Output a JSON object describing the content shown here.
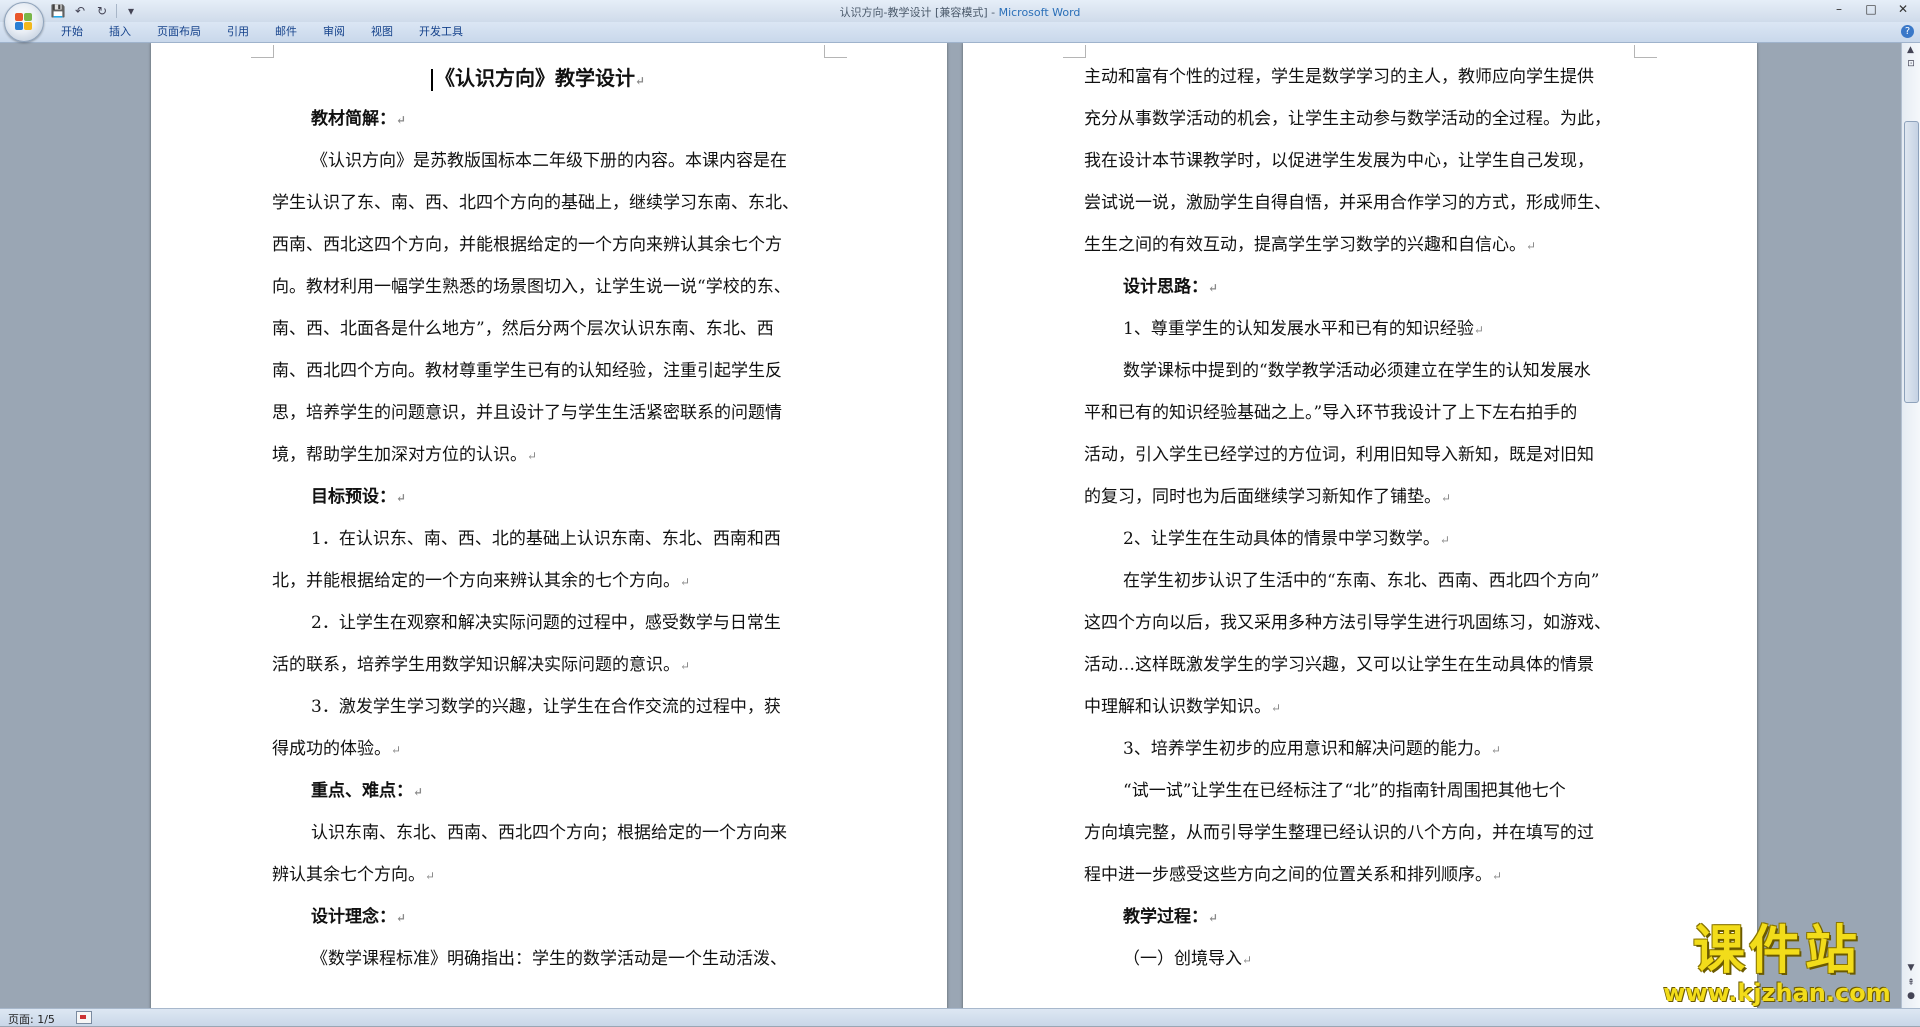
{
  "window": {
    "title_doc": "认识方向-教学设计 [兼容模式] - ",
    "title_app": "Microsoft Word",
    "minimize": "–",
    "maximize": "□",
    "close": "✕"
  },
  "qat": {
    "save_icon": "💾",
    "undo_icon": "↶",
    "redo_icon": "↻",
    "customize_icon": "▾"
  },
  "ribbon": {
    "tabs": [
      "开始",
      "插入",
      "页面布局",
      "引用",
      "邮件",
      "审阅",
      "视图",
      "开发工具"
    ],
    "help": "?"
  },
  "page1": {
    "title": "《认识方向》教学设计",
    "lines": [
      {
        "text": "教材简解：",
        "bold": true,
        "indent": true,
        "mark": true
      },
      {
        "text": "《认识方向》是苏教版国标本二年级下册的内容。本课内容是在",
        "indent": true
      },
      {
        "text": "学生认识了东、南、西、北四个方向的基础上，继续学习东南、东北、"
      },
      {
        "text": "西南、西北这四个方向，并能根据给定的一个方向来辨认其余七个方"
      },
      {
        "text": "向。教材利用一幅学生熟悉的场景图切入，让学生说一说“学校的东、"
      },
      {
        "text": "南、西、北面各是什么地方”，然后分两个层次认识东南、东北、西"
      },
      {
        "text": "南、西北四个方向。教材尊重学生已有的认知经验，注重引起学生反"
      },
      {
        "text": "思，培养学生的问题意识，并且设计了与学生生活紧密联系的问题情"
      },
      {
        "text": "境，帮助学生加深对方位的认识。",
        "mark": true
      },
      {
        "text": "目标预设：",
        "bold": true,
        "indent": true,
        "mark": true
      },
      {
        "text": "1．在认识东、南、西、北的基础上认识东南、东北、西南和西",
        "indent": true
      },
      {
        "text": "北，并能根据给定的一个方向来辨认其余的七个方向。",
        "mark": true
      },
      {
        "text": "2．让学生在观察和解决实际问题的过程中，感受数学与日常生",
        "indent": true
      },
      {
        "text": "活的联系，培养学生用数学知识解决实际问题的意识。",
        "mark": true
      },
      {
        "text": "3．激发学生学习数学的兴趣，让学生在合作交流的过程中，获",
        "indent": true
      },
      {
        "text": "得成功的体验。",
        "mark": true
      },
      {
        "text": "重点、难点：",
        "bold": true,
        "indent": true,
        "mark": true
      },
      {
        "text": "认识东南、东北、西南、西北四个方向；根据给定的一个方向来",
        "indent": true
      },
      {
        "text": "辨认其余七个方向。",
        "mark": true
      },
      {
        "text": "设计理念：",
        "bold": true,
        "indent": true,
        "mark": true
      },
      {
        "text": "《数学课程标准》明确指出：学生的数学活动是一个生动活泼、",
        "indent": true
      }
    ]
  },
  "page2": {
    "lines": [
      {
        "text": "主动和富有个性的过程，学生是数学学习的主人，教师应向学生提供"
      },
      {
        "text": "充分从事数学活动的机会，让学生主动参与数学活动的全过程。为此，"
      },
      {
        "text": "我在设计本节课教学时，以促进学生发展为中心，让学生自己发现，"
      },
      {
        "text": "尝试说一说，激励学生自得自悟，并采用合作学习的方式，形成师生、"
      },
      {
        "text": "生生之间的有效互动，提高学生学习数学的兴趣和自信心。",
        "mark": true
      },
      {
        "text": "设计思路：",
        "bold": true,
        "indent": true,
        "mark": true
      },
      {
        "text": "1、尊重学生的认知发展水平和已有的知识经验",
        "indent": true,
        "mark": true
      },
      {
        "text": "数学课标中提到的“数学教学活动必须建立在学生的认知发展水",
        "indent": true
      },
      {
        "text": "平和已有的知识经验基础之上。”导入环节我设计了上下左右拍手的"
      },
      {
        "text": "活动，引入学生已经学过的方位词，利用旧知导入新知，既是对旧知"
      },
      {
        "text": "的复习，同时也为后面继续学习新知作了铺垫。",
        "mark": true
      },
      {
        "text": "2、让学生在生动具体的情景中学习数学。",
        "indent": true,
        "mark": true
      },
      {
        "text": "在学生初步认识了生活中的“东南、东北、西南、西北四个方向”",
        "indent": true
      },
      {
        "text": "这四个方向以后，我又采用多种方法引导学生进行巩固练习，如游戏、"
      },
      {
        "text": "活动…这样既激发学生的学习兴趣，又可以让学生在生动具体的情景"
      },
      {
        "text": "中理解和认识数学知识。",
        "mark": true
      },
      {
        "text": "3、培养学生初步的应用意识和解决问题的能力。",
        "indent": true,
        "mark": true
      },
      {
        "text": "“试一试”让学生在已经标注了“北”的指南针周围把其他七个",
        "indent": true
      },
      {
        "text": "方向填完整，从而引导学生整理已经认识的八个方向，并在填写的过"
      },
      {
        "text": "程中进一步感受这些方向之间的位置关系和排列顺序。",
        "mark": true
      },
      {
        "text": "教学过程：",
        "bold": true,
        "indent": true,
        "mark": true
      },
      {
        "text": "（一）创境导入",
        "indent": true,
        "mark": true
      }
    ]
  },
  "paragraph_mark": "↵",
  "status": {
    "page": "页面: 1/5"
  },
  "watermark": {
    "main": "课件站",
    "url": "www.kjzhan.com"
  },
  "colors": {
    "ribbon_text": "#15428b",
    "app_blue": "#2a6fb8",
    "watermark": "#f2dc1a"
  }
}
